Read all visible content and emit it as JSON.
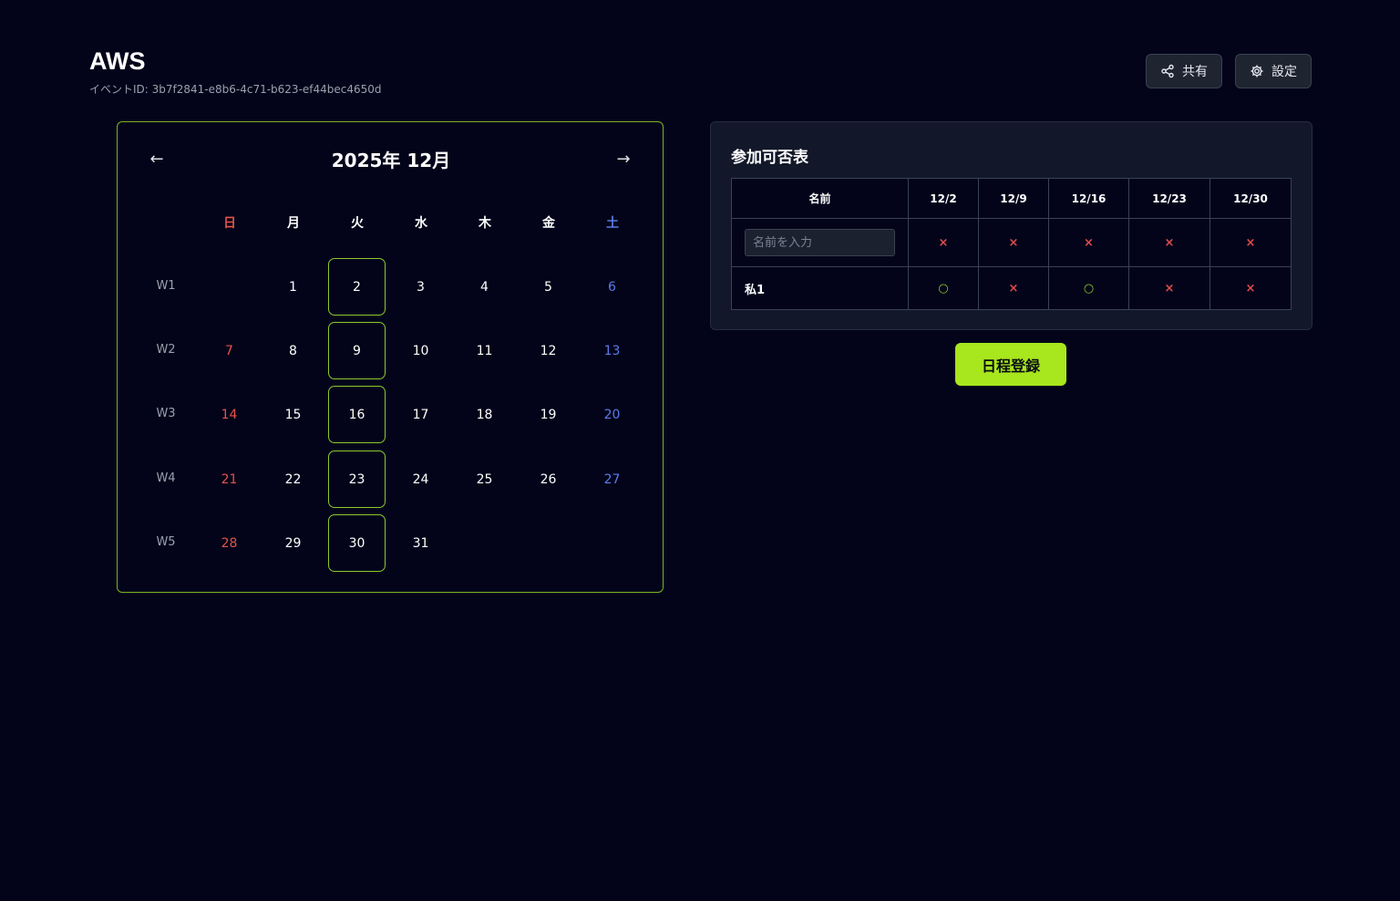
{
  "header": {
    "title": "AWS",
    "event_id": "イベントID: 3b7f2841-e8b6-4c71-b623-ef44bec4650d",
    "share_label": "共有",
    "settings_label": "設定"
  },
  "calendar": {
    "title": "2025年 12月",
    "prev_label": "←",
    "next_label": "→",
    "weekdays": [
      "日",
      "月",
      "火",
      "水",
      "木",
      "金",
      "土"
    ],
    "weeks": [
      {
        "label": "W1",
        "days": [
          "",
          "1",
          "2",
          "3",
          "4",
          "5",
          "6"
        ]
      },
      {
        "label": "W2",
        "days": [
          "7",
          "8",
          "9",
          "10",
          "11",
          "12",
          "13"
        ]
      },
      {
        "label": "W3",
        "days": [
          "14",
          "15",
          "16",
          "17",
          "18",
          "19",
          "20"
        ]
      },
      {
        "label": "W4",
        "days": [
          "21",
          "22",
          "23",
          "24",
          "25",
          "26",
          "27"
        ]
      },
      {
        "label": "W5",
        "days": [
          "28",
          "29",
          "30",
          "31",
          "",
          "",
          ""
        ]
      }
    ],
    "selected_days": [
      "2",
      "9",
      "16",
      "23",
      "30"
    ],
    "colors": {
      "sunday": "#e05548",
      "saturday": "#5a7ce8",
      "accent": "#8cc92a"
    }
  },
  "availability": {
    "title": "参加可否表",
    "name_header": "名前",
    "dates": [
      "12/2",
      "12/9",
      "12/16",
      "12/23",
      "12/30"
    ],
    "input_placeholder": "名前を入力",
    "input_row_marks": [
      "×",
      "×",
      "×",
      "×",
      "×"
    ],
    "rows": [
      {
        "name": "私1",
        "marks": [
          "○",
          "×",
          "○",
          "×",
          "×"
        ]
      }
    ]
  },
  "register_label": "日程登録"
}
